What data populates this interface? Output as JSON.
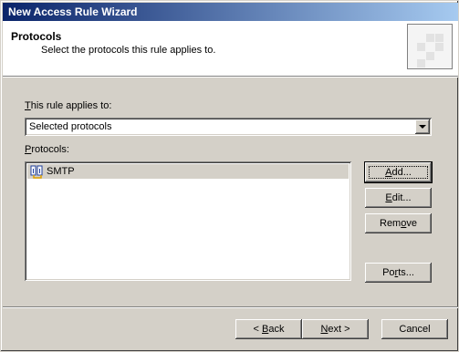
{
  "window": {
    "title": "New Access Rule Wizard"
  },
  "header": {
    "title": "Protocols",
    "subtitle": "Select the protocols this rule applies to."
  },
  "applies": {
    "label_accel": "T",
    "label_rest": "his rule applies to:",
    "selected": "Selected protocols"
  },
  "protocols": {
    "label_accel": "P",
    "label_rest": "rotocols:",
    "items": [
      {
        "name": "SMTP",
        "icon": "protocol-icon"
      }
    ]
  },
  "buttons": {
    "add": {
      "accel": "A",
      "rest": "dd..."
    },
    "edit": {
      "accel": "E",
      "rest": "dit..."
    },
    "remove": {
      "pre": "Rem",
      "accel": "o",
      "rest": "ve"
    },
    "ports": {
      "pre": "Po",
      "accel": "r",
      "rest": "ts..."
    }
  },
  "footer": {
    "back": {
      "pre": "< ",
      "accel": "B",
      "rest": "ack"
    },
    "next": {
      "accel": "N",
      "rest": "ext >"
    },
    "cancel": "Cancel"
  },
  "colors": {
    "title_start": "#0a246a",
    "title_end": "#a6caf0",
    "face": "#d4d0c8"
  }
}
